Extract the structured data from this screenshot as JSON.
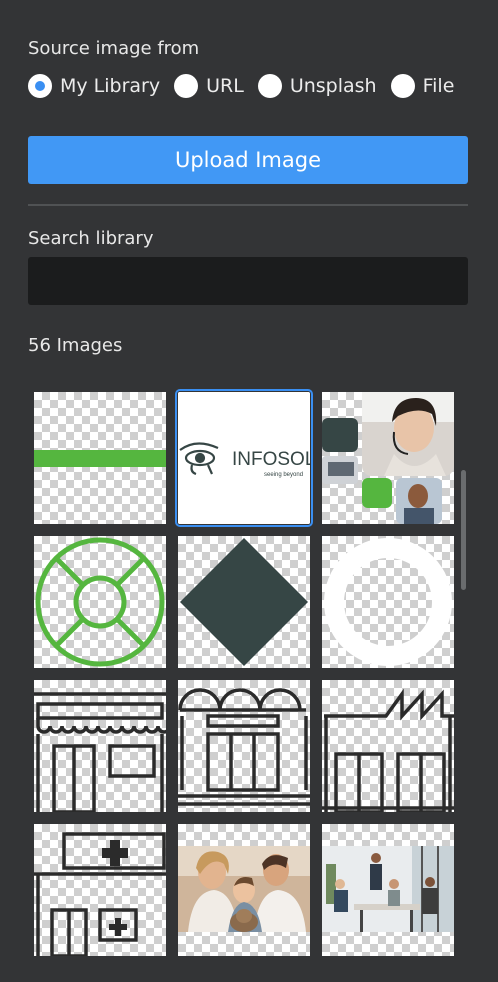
{
  "source": {
    "label": "Source image from",
    "options": [
      {
        "label": "My Library",
        "checked": true
      },
      {
        "label": "URL",
        "checked": false
      },
      {
        "label": "Unsplash",
        "checked": false
      },
      {
        "label": "File",
        "checked": false
      }
    ]
  },
  "upload_button": {
    "label": "Upload Image"
  },
  "search": {
    "label": "Search library",
    "value": "",
    "placeholder": ""
  },
  "library": {
    "count_label": "56 Images",
    "images": [
      {
        "name": "green-line-graphic"
      },
      {
        "name": "infosol-logo",
        "text": "INFOSOL",
        "tagline": "seeing beyond",
        "selected": true
      },
      {
        "name": "call-center-collage"
      },
      {
        "name": "lifebuoy-outline"
      },
      {
        "name": "dark-diamond"
      },
      {
        "name": "white-ring"
      },
      {
        "name": "storefront-awning-icon"
      },
      {
        "name": "bakery-storefront-icon"
      },
      {
        "name": "factory-icon"
      },
      {
        "name": "hospital-icon"
      },
      {
        "name": "family-dog-photo"
      },
      {
        "name": "office-meeting-photo"
      }
    ]
  },
  "colors": {
    "accent": "#4198f5",
    "panel": "#333436",
    "input": "#1b1c1d",
    "brand_green": "#55b63f",
    "dark_slate": "#364645"
  }
}
